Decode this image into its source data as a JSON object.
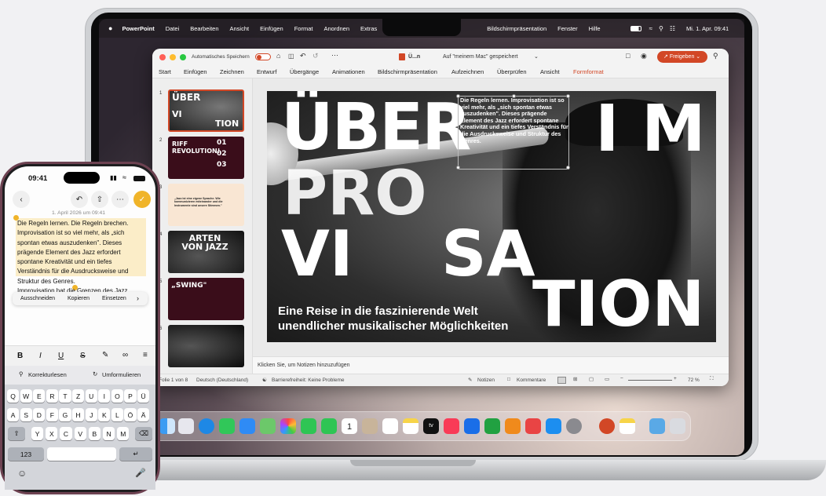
{
  "menubar": {
    "brand": "PowerPoint",
    "items": [
      "Datei",
      "Bearbeiten",
      "Ansicht",
      "Einfügen",
      "Format",
      "Anordnen",
      "Extras"
    ],
    "right_items": [
      "Bildschirmpräsentation",
      "Fenster",
      "Hilfe"
    ],
    "datetime": "Mi. 1. Apr. 09:41"
  },
  "window": {
    "autosave_label": "Automatisches Speichern",
    "doc_title": "Ü...n",
    "saved_label": "Auf \"meinem Mac\" gespeichert",
    "share_label": "Freigeben"
  },
  "ribbon": {
    "tabs": [
      "Start",
      "Einfügen",
      "Zeichnen",
      "Entwurf",
      "Übergänge",
      "Animationen",
      "Bildschirmpräsentation",
      "Aufzeichnen",
      "Überprüfen",
      "Ansicht",
      "Formformat"
    ],
    "active_color": "#d24726"
  },
  "thumbnails": {
    "numbers": [
      "1",
      "2",
      "3",
      "4",
      "5",
      "6"
    ],
    "slide2": {
      "title": "RIFF REVOLUTION!",
      "n1": "01",
      "n2": "02",
      "n3": "03"
    },
    "slide3": {
      "quote": "„Jazz ist eine eigene Sprache. Wie kommunizieren miteinander und die Instrumente sind unsere Stimmen.\""
    },
    "slide4": {
      "title": "ARTEN VON JAZZ"
    },
    "slide5": {
      "title": "„SWING\""
    }
  },
  "slide": {
    "word_uber": "ÜBER",
    "word_im": "I M",
    "word_pro": "PRO",
    "word_vi": "VI",
    "word_sa": "SA",
    "word_tion": "TION",
    "textbox": "Die Regeln lernen. Improvisation ist so viel mehr, als „sich spontan etwas auszudenken\". Dieses prägende Element des Jazz erfordert spontane Kreativität und ein tiefes Verständnis für die Ausdrucksweise und Struktur des Genres.",
    "subtitle_line1": "Eine Reise in die faszinierende Welt",
    "subtitle_line2": "unendlicher musikalischer Möglichkeiten"
  },
  "notes": {
    "placeholder": "Klicken Sie, um Notizen hinzuzufügen"
  },
  "status": {
    "slide_info": "Folie 1 von 8",
    "language": "Deutsch (Deutschland)",
    "accessibility": "Barrierefreiheit: Keine Probleme",
    "notes_label": "Notizen",
    "comments_label": "Kommentare",
    "zoom": "72 %"
  },
  "dock": {
    "calendar_day": "1",
    "tv_label": "tv"
  },
  "phone": {
    "time": "09:41",
    "date": "1. April 2026 um 09:41",
    "note_lines": [
      "Die Regeln lernen. Die Regeln brechen.",
      "Improvisation ist so viel mehr, als „sich",
      "spontan etwas auszudenken\". Dieses",
      "prägende Element des Jazz erfordert",
      "spontane Kreativität und ein tiefes",
      "Verständnis für die Ausdrucksweise und",
      "Struktur des Genres."
    ],
    "hidden_line": "Improvisation hat die Grenzen des Jazz",
    "below_line": "Innovationen der amerikanischen Musik dar.",
    "edit_menu": [
      "Ausschneiden",
      "Kopieren",
      "Einsetzen"
    ],
    "tools": [
      "Korrekturlesen",
      "Umformulieren"
    ],
    "keys_row1": [
      "Q",
      "W",
      "E",
      "R",
      "T",
      "Z",
      "U",
      "I",
      "O",
      "P",
      "Ü"
    ],
    "keys_row2": [
      "A",
      "S",
      "D",
      "F",
      "G",
      "H",
      "J",
      "K",
      "L",
      "Ö",
      "Ä"
    ],
    "keys_row3": [
      "Y",
      "X",
      "C",
      "V",
      "B",
      "N",
      "M"
    ],
    "key_123": "123"
  },
  "colors": {
    "accent": "#d24726",
    "phone_frame": "#6d4251",
    "highlight": "#fbedc8",
    "done_button": "#f0b429"
  }
}
